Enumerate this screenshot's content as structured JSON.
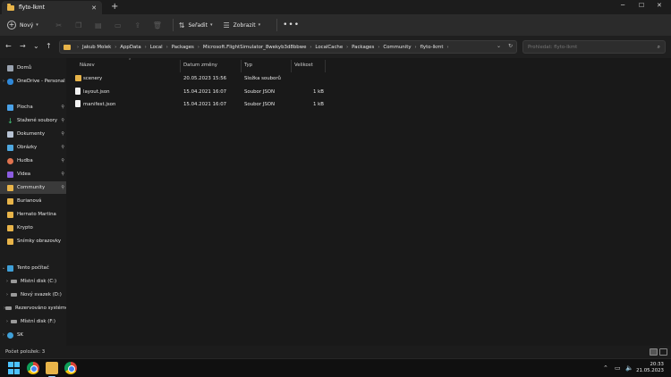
{
  "window": {
    "tab_title": "flyto-lkmt",
    "new_tab": "+",
    "minimize": "─",
    "maximize": "☐",
    "close": "✕"
  },
  "toolbar": {
    "new_label": "Nový",
    "sort_label": "Seřadit",
    "view_label": "Zobrazit",
    "more_label": "•••"
  },
  "address": {
    "crumbs": [
      "Jakub Molek",
      "AppData",
      "Local",
      "Packages",
      "Microsoft.FlightSimulator_8wekyb3d8bbwe",
      "LocalCache",
      "Packages",
      "Community",
      "flyto-lkmt"
    ],
    "search_placeholder": "Prohledat: flyto-lkmt"
  },
  "sidebar": {
    "items": [
      {
        "label": "Domů",
        "icon": "home-icon"
      },
      {
        "label": "OneDrive - Personal",
        "icon": "cloud-icon"
      },
      {
        "label": "Plocha",
        "icon": "desktop-icon"
      },
      {
        "label": "Stažené soubory",
        "icon": "download-icon"
      },
      {
        "label": "Dokumenty",
        "icon": "document-icon"
      },
      {
        "label": "Obrázky",
        "icon": "pictures-icon"
      },
      {
        "label": "Hudba",
        "icon": "music-icon"
      },
      {
        "label": "Videa",
        "icon": "video-icon"
      },
      {
        "label": "Community",
        "icon": "folder-icon"
      },
      {
        "label": "Burianová",
        "icon": "folder-icon"
      },
      {
        "label": "Hernato Martina",
        "icon": "folder-icon"
      },
      {
        "label": "Krypto",
        "icon": "folder-icon"
      },
      {
        "label": "Snímky obrazovky",
        "icon": "folder-icon"
      },
      {
        "label": "Tento počítač",
        "icon": "computer-icon"
      },
      {
        "label": "Místní disk (C:)",
        "icon": "drive-icon"
      },
      {
        "label": "Nový svazek (D:)",
        "icon": "drive-icon"
      },
      {
        "label": "Rezervováno systémem (E:)",
        "icon": "drive-icon"
      },
      {
        "label": "Místní disk (F:)",
        "icon": "drive-icon"
      },
      {
        "label": "SK",
        "icon": "network-icon"
      }
    ]
  },
  "columns": {
    "name": "Název",
    "date": "Datum změny",
    "type": "Typ",
    "size": "Velikost"
  },
  "files": [
    {
      "name": "scenery",
      "date": "20.05.2023 15:56",
      "type": "Složka souborů",
      "size": "",
      "kind": "folder"
    },
    {
      "name": "layout.json",
      "date": "15.04.2021 16:07",
      "type": "Soubor JSON",
      "size": "1 kB",
      "kind": "file"
    },
    {
      "name": "manifest.json",
      "date": "15.04.2021 16:07",
      "type": "Soubor JSON",
      "size": "1 kB",
      "kind": "file"
    }
  ],
  "status": {
    "count_text": "Počet položek: 3"
  },
  "taskbar": {
    "time": "20:33",
    "date": "21.05.2023"
  }
}
